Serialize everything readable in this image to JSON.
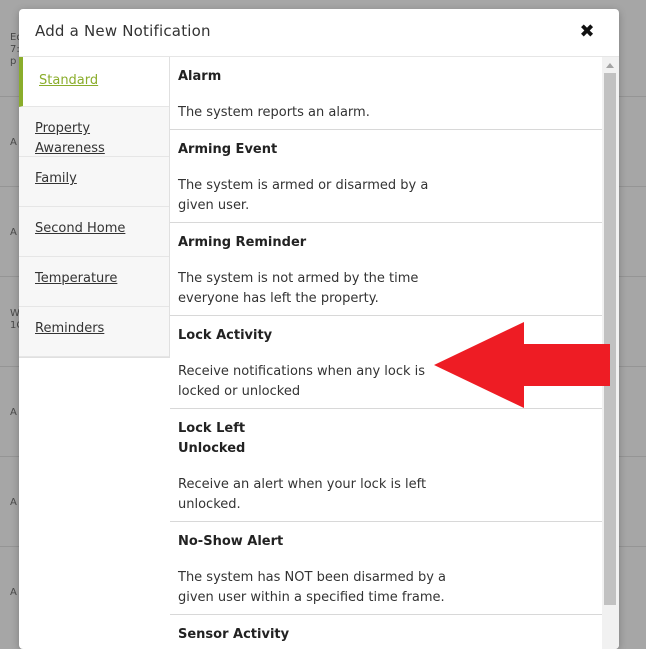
{
  "background": {
    "rows": [
      {
        "text": "Ed\n7:\np"
      },
      {
        "text": "A"
      },
      {
        "text": "A"
      },
      {
        "text": "W\n1C"
      },
      {
        "text": "A"
      },
      {
        "text": "A"
      },
      {
        "text": "A"
      }
    ]
  },
  "modal": {
    "title": "Add a New Notification",
    "close_icon": "close-icon"
  },
  "tabs": [
    {
      "label": "Standard",
      "active": true
    },
    {
      "label": "Property Awareness",
      "active": false
    },
    {
      "label": "Family",
      "active": false
    },
    {
      "label": "Second Home",
      "active": false
    },
    {
      "label": "Temperature",
      "active": false
    },
    {
      "label": "Reminders",
      "active": false
    }
  ],
  "items": [
    {
      "title": "Alarm",
      "desc": "The system reports an alarm."
    },
    {
      "title": "Arming Event",
      "desc": "The system is armed or disarmed by a given user."
    },
    {
      "title": "Arming Reminder",
      "desc": "The system is not armed by the time everyone has left the property."
    },
    {
      "title": "Lock Activity",
      "desc": "Receive notifications when any lock is locked or unlocked"
    },
    {
      "title": "Lock Left Unlocked",
      "desc": "Receive an alert when your lock is left unlocked."
    },
    {
      "title": "No-Show Alert",
      "desc": "The system has NOT been disarmed by a given user within a specified time frame."
    },
    {
      "title": "Sensor Activity",
      "desc": ""
    }
  ],
  "colors": {
    "accent": "#8aad2b",
    "arrow": "#ee1c24"
  }
}
